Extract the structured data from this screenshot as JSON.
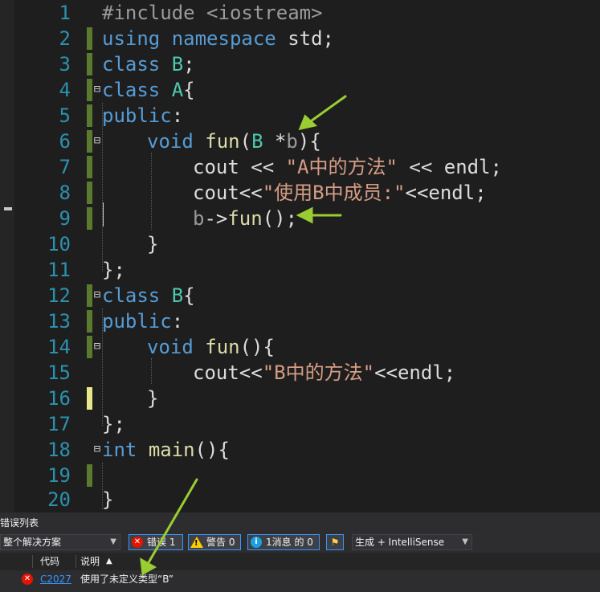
{
  "editor": {
    "line_numbers": [
      "1",
      "2",
      "3",
      "4",
      "5",
      "6",
      "7",
      "8",
      "9",
      "10",
      "11",
      "12",
      "13",
      "14",
      "15",
      "16",
      "17",
      "18",
      "19",
      "20"
    ],
    "code": {
      "l1": {
        "pp": "#include",
        "rest": " <iostream>"
      },
      "l2": {
        "kw1": "using",
        "kw2": "namespace",
        "rest": " std;"
      },
      "l3": {
        "kw": "class",
        "ty": "B",
        "rest": ";"
      },
      "l4": {
        "kw": "class",
        "ty": "A",
        "rest": "{"
      },
      "l5": {
        "kw": "public",
        "rest": ":"
      },
      "l6": {
        "kw": "void",
        "fn": "fun",
        "p1": "(",
        "ty": "B",
        "op": " *",
        "pm": "b",
        "p2": "){"
      },
      "l7": {
        "id": "cout",
        "op1": " << ",
        "st": "\"A中的方法\"",
        "op2": " << ",
        "id2": "endl",
        "end": ";"
      },
      "l8": {
        "id": "cout",
        "op1": "<<",
        "st": "\"使用B中成员:\"",
        "op2": "<<",
        "id2": "endl",
        "end": ";"
      },
      "l9": {
        "pm": "b",
        "op": "->",
        "fn": "fun",
        "rest": "();"
      },
      "l10": {
        "rest": "}"
      },
      "l11": {
        "rest": "};"
      },
      "l12": {
        "kw": "class",
        "ty": "B",
        "rest": "{"
      },
      "l13": {
        "kw": "public",
        "rest": ":"
      },
      "l14": {
        "kw": "void",
        "fn": "fun",
        "rest": "(){"
      },
      "l15": {
        "id": "cout",
        "op1": "<<",
        "st": "\"B中的方法\"",
        "op2": "<<",
        "id2": "endl",
        "end": ";"
      },
      "l16": {
        "rest": "}"
      },
      "l17": {
        "rest": "};"
      },
      "l18": {
        "kw": "int",
        "fn": "main",
        "rest": "(){"
      },
      "l20": {
        "rest": "}"
      }
    },
    "fold_symbol": "⊟",
    "colors": {
      "keyword": "#569cd6",
      "type": "#4ec9b0",
      "function": "#dcdcaa",
      "string": "#d69d85",
      "line_number": "#2b91af",
      "annotation_arrow": "#9acd32"
    }
  },
  "error_list": {
    "title": "错误列表",
    "scope_dropdown": "整个解决方案",
    "errors_button": "错误 1",
    "warnings_button": "警告 0",
    "messages_button": "1消息 的 0",
    "source_dropdown": "生成 + IntelliSense",
    "columns": {
      "code": "代码",
      "description": "说明"
    },
    "sort_indicator": "▲",
    "rows": [
      {
        "code": "C2027",
        "description": "使用了未定义类型“B”"
      }
    ]
  }
}
